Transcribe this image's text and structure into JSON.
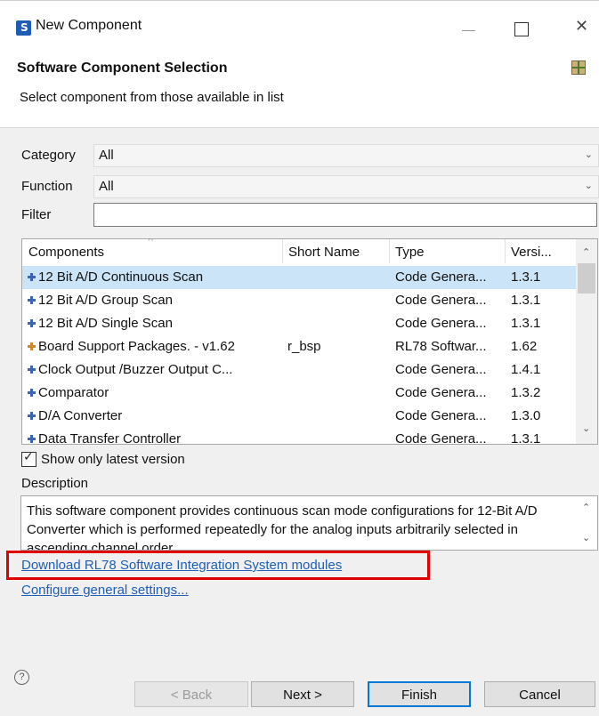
{
  "window": {
    "title": "New Component"
  },
  "header": {
    "title": "Software Component Selection",
    "subtitle": "Select component from those available in list"
  },
  "filters": {
    "category_label": "Category",
    "category_value": "All",
    "function_label": "Function",
    "function_value": "All",
    "filter_label": "Filter",
    "filter_value": ""
  },
  "table": {
    "columns": [
      "Components",
      "Short Name",
      "Type",
      "Versi..."
    ],
    "rows": [
      {
        "name": "12 Bit A/D Continuous Scan",
        "short": "",
        "type": "Code Genera...",
        "version": "1.3.1",
        "icon_color": "#3b64b5"
      },
      {
        "name": "12 Bit A/D Group Scan",
        "short": "",
        "type": "Code Genera...",
        "version": "1.3.1",
        "icon_color": "#3b64b5"
      },
      {
        "name": "12 Bit A/D Single Scan",
        "short": "",
        "type": "Code Genera...",
        "version": "1.3.1",
        "icon_color": "#3b64b5"
      },
      {
        "name": "Board Support Packages. - v1.62",
        "short": "r_bsp",
        "type": "RL78 Softwar...",
        "version": "1.62",
        "icon_color": "#d1862a"
      },
      {
        "name": "Clock Output /Buzzer Output C...",
        "short": "",
        "type": "Code Genera...",
        "version": "1.4.1",
        "icon_color": "#3b64b5"
      },
      {
        "name": "Comparator",
        "short": "",
        "type": "Code Genera...",
        "version": "1.3.2",
        "icon_color": "#3b64b5"
      },
      {
        "name": "D/A Converter",
        "short": "",
        "type": "Code Genera...",
        "version": "1.3.0",
        "icon_color": "#3b64b5"
      },
      {
        "name": "Data Transfer Controller",
        "short": "",
        "type": "Code Genera...",
        "version": "1.3.1",
        "icon_color": "#3b64b5"
      }
    ]
  },
  "options": {
    "latest_version_label": "Show only latest version",
    "latest_version_checked": true
  },
  "description": {
    "label": "Description",
    "text": "This software component provides continuous scan mode configurations for 12-Bit A/D Converter which is performed repeatedly for the analog inputs arbitrarily selected in ascending channel order"
  },
  "links": {
    "download": "Download RL78 Software Integration System modules",
    "configure": "Configure general settings..."
  },
  "buttons": {
    "back": "< Back",
    "next": "Next >",
    "finish": "Finish",
    "cancel": "Cancel",
    "help": "?"
  },
  "colors": {
    "accent": "#0078d7",
    "link": "#1f5fb8",
    "selection": "#cce4f7",
    "highlight_box": "#e00000"
  },
  "icons": {
    "app": "component-app-icon",
    "banner": "component-banner-icon",
    "close": "close-icon"
  }
}
